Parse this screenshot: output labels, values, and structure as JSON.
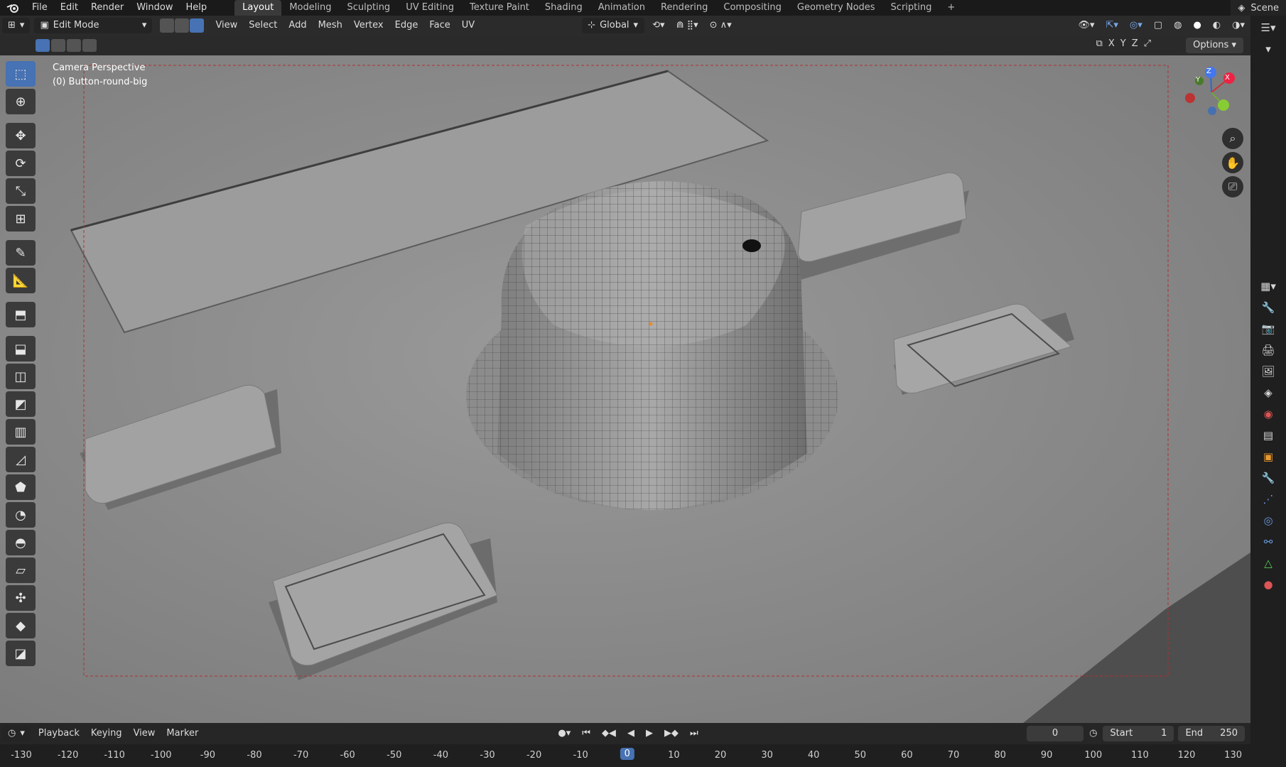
{
  "menubar": {
    "items": [
      "File",
      "Edit",
      "Render",
      "Window",
      "Help"
    ],
    "workspaces": [
      "Layout",
      "Modeling",
      "Sculpting",
      "UV Editing",
      "Texture Paint",
      "Shading",
      "Animation",
      "Rendering",
      "Compositing",
      "Geometry Nodes",
      "Scripting"
    ],
    "active_workspace": "Layout",
    "add_workspace": "+",
    "scene_label": "Scene"
  },
  "header": {
    "mode": "Edit Mode",
    "menus": [
      "View",
      "Select",
      "Add",
      "Mesh",
      "Vertex",
      "Edge",
      "Face",
      "UV"
    ],
    "transform_orientation": "Global",
    "axes": [
      "X",
      "Y",
      "Z"
    ],
    "options_label": "Options"
  },
  "viewport": {
    "view_name": "Camera Perspective",
    "object_name": "(0) Button-round-big",
    "gizmo": {
      "x": "X",
      "y": "Y",
      "z": "Z"
    }
  },
  "timeline": {
    "menus": [
      "Playback",
      "Keying",
      "View",
      "Marker"
    ],
    "current_frame": "0",
    "start_label": "Start",
    "start_value": "1",
    "end_label": "End",
    "end_value": "250",
    "ruler": [
      "-130",
      "-120",
      "-110",
      "-100",
      "-90",
      "-80",
      "-70",
      "-60",
      "-50",
      "-40",
      "-30",
      "-20",
      "-10",
      "0",
      "10",
      "20",
      "30",
      "40",
      "50",
      "60",
      "70",
      "80",
      "90",
      "100",
      "110",
      "120",
      "130"
    ]
  },
  "colors": {
    "accent": "#4772b3",
    "viewport_bg": "#8a8a8a",
    "camera_frame": "#b03030"
  }
}
